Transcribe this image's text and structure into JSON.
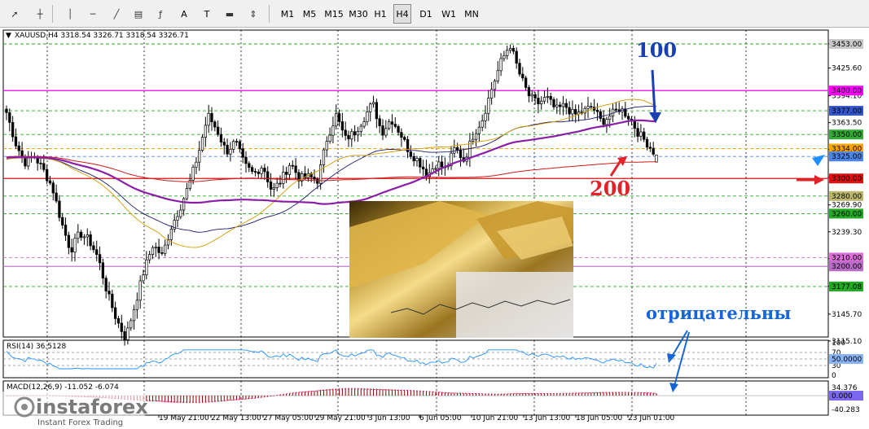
{
  "toolbar": {
    "tools": [
      {
        "name": "cursor-icon"
      },
      {
        "name": "crosshair-icon"
      },
      {
        "name": "vertical-line-icon"
      },
      {
        "name": "horizontal-line-icon"
      },
      {
        "name": "trendline-icon"
      },
      {
        "name": "equidistant-channel-icon"
      },
      {
        "name": "fibonacci-icon"
      },
      {
        "name": "text-tool",
        "label": "A"
      },
      {
        "name": "text-label-tool",
        "label": "T"
      },
      {
        "name": "rectangle-tool"
      },
      {
        "name": "arrows-tool"
      }
    ],
    "timeframes": [
      "M1",
      "M5",
      "M15",
      "M30",
      "H1",
      "H4",
      "D1",
      "W1",
      "MN"
    ],
    "active_timeframe": "H4"
  },
  "chart": {
    "header": "XAUUSD,H4  3318.54 3326.71 3318.54 3326.71",
    "rsi_label": "RSI(14) 36.5128",
    "macd_label": "MACD(12,26,9) -11.052 -6.074",
    "annotations": {
      "a100": "100",
      "a200": "200",
      "neg": "отрицательны"
    },
    "watermark": {
      "brand": "instaforex",
      "tagline": "Instant Forex Trading"
    }
  },
  "colors": {
    "ma100": "#8a1ea8",
    "ma200": "#cc1a1a",
    "ma50": "#d49a00",
    "ma_blue": "#1a1a70",
    "annot_blue": "#1565d8",
    "annot_red": "#e3222a",
    "rsi_line": "#1e90ff",
    "macd_hist": "#8b0000"
  },
  "chart_data": {
    "type": "candlestick",
    "symbol": "XAUUSD",
    "timeframe": "H4",
    "ohlc_last": {
      "open": 3318.54,
      "high": 3326.71,
      "low": 3318.54,
      "close": 3326.71
    },
    "price_axis_ticks": [
      3453.0,
      3425.6,
      3394.1,
      3363.5,
      3332.9,
      3301.4,
      3269.9,
      3239.3,
      3208.8,
      3177.2,
      3145.7,
      3115.1
    ],
    "time_axis_ticks": [
      "19 May 21:00",
      "22 May 13:00",
      "27 May 05:00",
      "29 May 21:00",
      "3 Jun 13:00",
      "6 Jun 05:00",
      "10 Jun 21:00",
      "13 Jun 13:00",
      "18 Jun 05:00",
      "23 Jun 01:00"
    ],
    "level_labels": [
      {
        "value": 3453.0,
        "color": "#c8c8c8",
        "text_color": "#000000"
      },
      {
        "value": 3400.0,
        "color": "#ff00ff",
        "text_color": "#ffffff"
      },
      {
        "value": 3377.0,
        "color": "#3355cc",
        "text_color": "#ffffff"
      },
      {
        "value": 3350.0,
        "color": "#33aa33",
        "text_color": "#ffffff"
      },
      {
        "value": 3334.0,
        "color": "#ffa500",
        "text_color": "#ffffff"
      },
      {
        "value": 3325.0,
        "color": "#4a86e8",
        "text_color": "#ffffff"
      },
      {
        "value": 3300.0,
        "color": "#e01010",
        "text_color": "#ffffff"
      },
      {
        "value": 3280.0,
        "color": "#bdb76b",
        "text_color": "#ffffff"
      },
      {
        "value": 3260.0,
        "color": "#22aa22",
        "text_color": "#ffffff"
      },
      {
        "value": 3210.0,
        "color": "#da70d6",
        "text_color": "#ffffff"
      },
      {
        "value": 3200.0,
        "color": "#b86cc8",
        "text_color": "#ffffff"
      },
      {
        "value": 3177.08,
        "color": "#22aa22",
        "text_color": "#ffffff"
      }
    ],
    "horizontal_lines": [
      {
        "value": 3453.0,
        "color": "#22aa22",
        "style": "dashed"
      },
      {
        "value": 3400.0,
        "color": "#ff00ff",
        "style": "solid"
      },
      {
        "value": 3377.0,
        "color": "#22aa22",
        "style": "dashed"
      },
      {
        "value": 3350.0,
        "color": "#22aa22",
        "style": "dashed"
      },
      {
        "value": 3334.0,
        "color": "#ffa500",
        "style": "dashed"
      },
      {
        "value": 3325.0,
        "color": "#4a86e8",
        "style": "dashed"
      },
      {
        "value": 3300.0,
        "color": "#e01010",
        "style": "solid"
      },
      {
        "value": 3280.0,
        "color": "#22aa22",
        "style": "dashed"
      },
      {
        "value": 3260.0,
        "color": "#22aa22",
        "style": "dashed"
      },
      {
        "value": 3210.0,
        "color": "#da70d6",
        "style": "dashed"
      },
      {
        "value": 3200.0,
        "color": "#b86cc8",
        "style": "solid"
      },
      {
        "value": 3177.08,
        "color": "#22aa22",
        "style": "dashed"
      }
    ],
    "close_path": [
      3375,
      3340,
      3318,
      3326,
      3310,
      3290,
      3250,
      3218,
      3238,
      3230,
      3210,
      3170,
      3140,
      3118,
      3155,
      3195,
      3225,
      3212,
      3245,
      3268,
      3295,
      3330,
      3372,
      3355,
      3330,
      3342,
      3315,
      3305,
      3315,
      3285,
      3298,
      3318,
      3300,
      3302,
      3298,
      3345,
      3372,
      3345,
      3352,
      3368,
      3386,
      3352,
      3368,
      3352,
      3330,
      3320,
      3304,
      3318,
      3310,
      3335,
      3320,
      3350,
      3368,
      3402,
      3432,
      3453,
      3420,
      3395,
      3385,
      3392,
      3378,
      3383,
      3372,
      3376,
      3382,
      3364,
      3372,
      3380,
      3370,
      3352,
      3340,
      3326
    ],
    "rsi": {
      "value": 36.5128,
      "levels": [
        70,
        50,
        30
      ],
      "axis": [
        0,
        100
      ]
    },
    "macd": {
      "main": -11.052,
      "signal": -6.074,
      "axis_labels": [
        34.376,
        0.0,
        -40.283
      ]
    },
    "moving_averages": [
      {
        "period": 100,
        "color": "#8a1ea8"
      },
      {
        "period": 200,
        "color": "#cc1a1a"
      }
    ]
  }
}
